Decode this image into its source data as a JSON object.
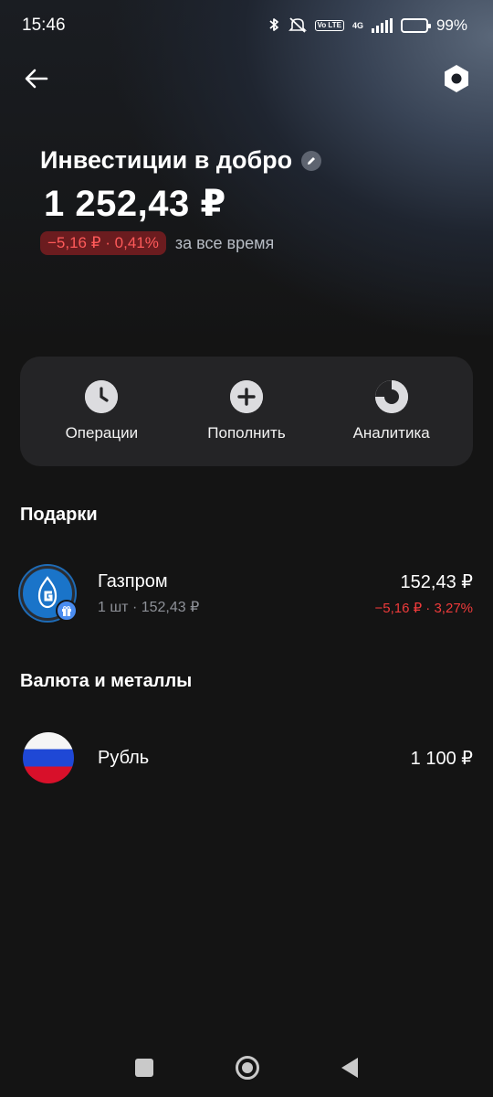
{
  "status_bar": {
    "time": "15:46",
    "battery": "99%",
    "volte": "Vo LTE",
    "network": "4G"
  },
  "header": {
    "title": "Инвестиции в добро",
    "balance": "1 252,43 ₽",
    "change": "−5,16 ₽ · 0,41%",
    "period": "за все время"
  },
  "actions": [
    {
      "label": "Операции",
      "icon": "clock-icon"
    },
    {
      "label": "Пополнить",
      "icon": "plus-icon"
    },
    {
      "label": "Аналитика",
      "icon": "donut-chart-icon"
    }
  ],
  "sections": {
    "gifts": {
      "title": "Подарки",
      "items": [
        {
          "name": "Газпром",
          "sub": "1 шт · 152,43 ₽",
          "value": "152,43 ₽",
          "change": "−5,16 ₽ · 3,27%"
        }
      ]
    },
    "currency": {
      "title": "Валюта и металлы",
      "items": [
        {
          "name": "Рубль",
          "value": "1 100 ₽"
        }
      ]
    }
  },
  "colors": {
    "negative": "#ef3b3b",
    "card_bg": "#242426",
    "background": "#141414"
  }
}
